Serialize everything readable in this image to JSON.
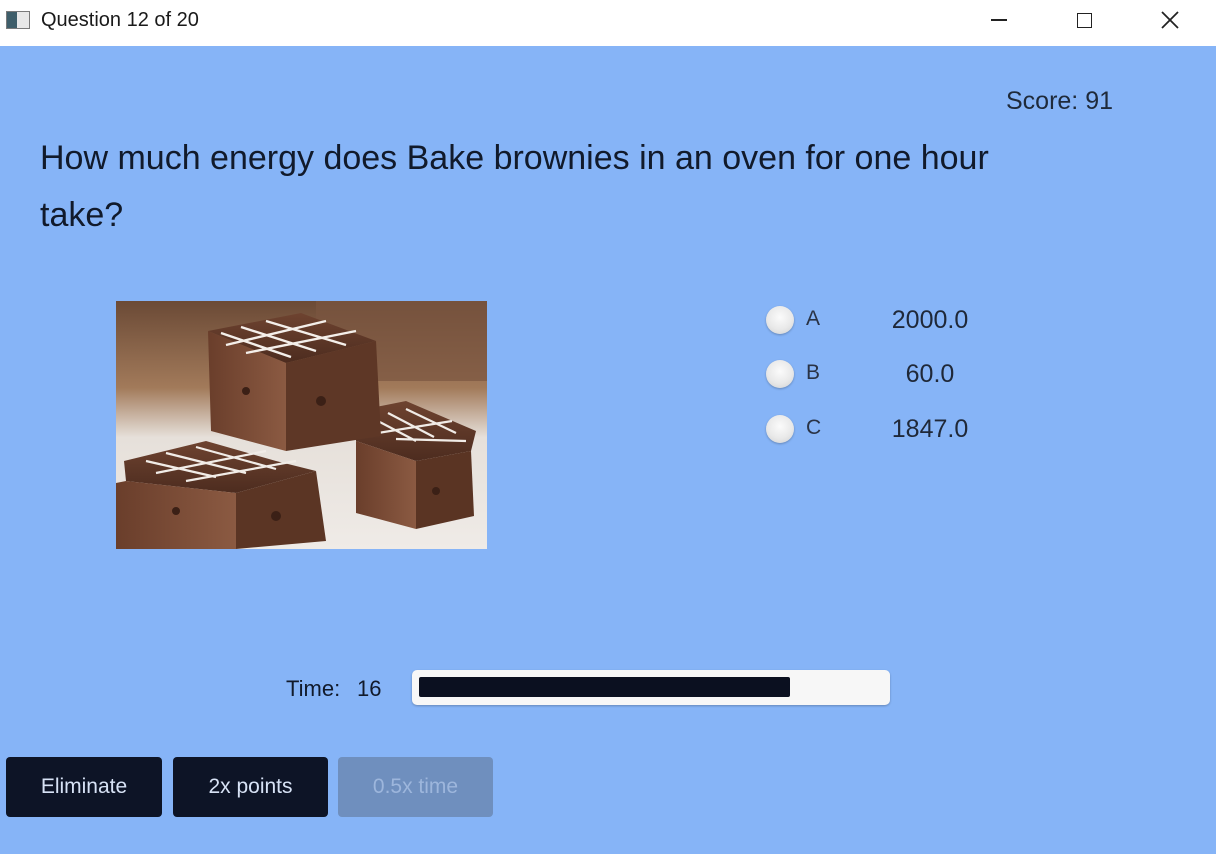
{
  "window": {
    "title": "Question 12 of 20",
    "controls": [
      "minimize",
      "maximize",
      "close"
    ]
  },
  "score": "Score: 91",
  "question": "How much energy does Bake brownies in an oven for one hour take?",
  "image": {
    "subject": "brownies-photo"
  },
  "answers": [
    {
      "letter": "A",
      "value": "2000.0",
      "selected": false
    },
    {
      "letter": "B",
      "value": "60.0",
      "selected": false
    },
    {
      "letter": "C",
      "value": "1847.0",
      "selected": false
    }
  ],
  "timer": {
    "label": "Time:",
    "value": "16",
    "progress": 0.8
  },
  "powerups": {
    "eliminate": "Eliminate",
    "double_points": "2x points",
    "half_time": "0.5x time"
  },
  "colors": {
    "background": "#86b4f7",
    "button": "#0d1426",
    "button_disabled": "#6f8fbe",
    "progress_fill": "#0b1020"
  }
}
